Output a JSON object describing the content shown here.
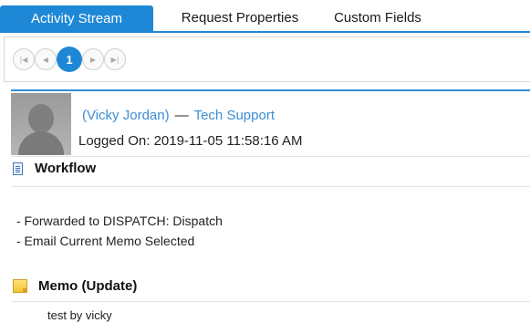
{
  "tabs": [
    {
      "label": "Activity Stream",
      "active": true
    },
    {
      "label": "Request Properties",
      "active": false
    },
    {
      "label": "Custom Fields",
      "active": false
    }
  ],
  "pager": {
    "first_icon": "first-page-icon",
    "prev_icon": "previous-page-icon",
    "current_page": "1",
    "next_icon": "next-page-icon",
    "last_icon": "last-page-icon"
  },
  "activity": {
    "user": "(Vicky Jordan)",
    "separator": "—",
    "group": "Tech Support",
    "logged_on": "Logged On: 2019-11-05 11:58:16 AM"
  },
  "workflow": {
    "title": "Workflow",
    "icon": "document-icon",
    "lines": [
      "- Forwarded to DISPATCH: Dispatch",
      "- Email Current Memo Selected"
    ]
  },
  "memo": {
    "title": "Memo (Update)",
    "icon": "memo-note-icon",
    "body": "test by vicky"
  },
  "colors": {
    "accent": "#1e88d6",
    "link": "#3b8ed4"
  }
}
